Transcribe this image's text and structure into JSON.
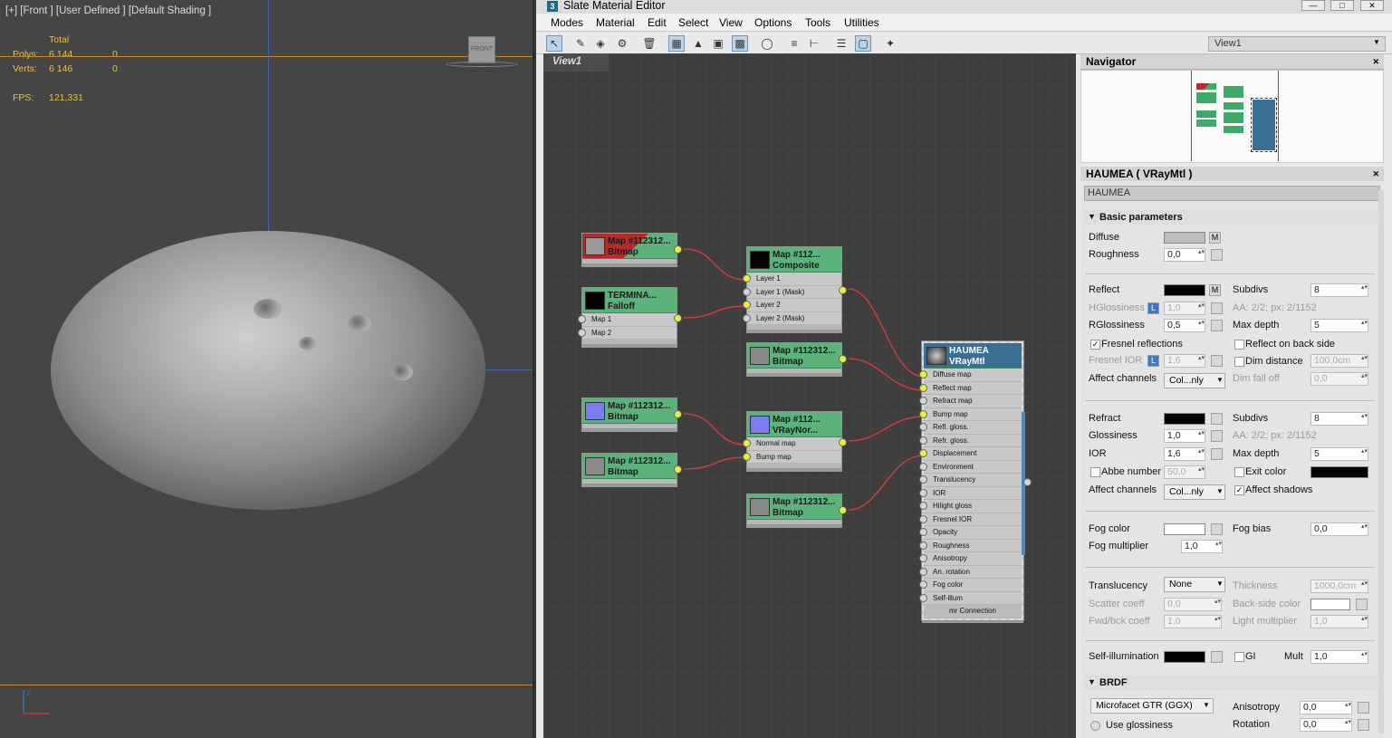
{
  "viewport": {
    "label": "[+] [Front ] [User Defined ] [Default Shading ]",
    "total_label": "Total",
    "polys_label": "Polys:",
    "polys_value": "6 144",
    "polys_sel": "0",
    "verts_label": "Verts:",
    "verts_value": "6 146",
    "verts_sel": "0",
    "fps_label": "FPS:",
    "fps_value": "121,331",
    "viewcube_label": "FRONT"
  },
  "editor": {
    "title": "Slate Material Editor",
    "menus": [
      "Modes",
      "Material",
      "Edit",
      "Select",
      "View",
      "Options",
      "Tools",
      "Utilities"
    ],
    "view_select": "View1",
    "view_tab": "View1"
  },
  "nodes": {
    "bitmap1": {
      "line1": "Map #112312...",
      "line2": "Bitmap"
    },
    "falloff": {
      "line1": "TERMINA...",
      "line2": "Falloff",
      "slots": [
        "Map 1",
        "Map 2"
      ]
    },
    "composite": {
      "line1": "Map #112...",
      "line2": "Composite",
      "slots": [
        "Layer 1",
        "Layer 1 (Mask)",
        "Layer 2",
        "Layer 2 (Mask)"
      ]
    },
    "bitmap2": {
      "line1": "Map #112312...",
      "line2": "Bitmap"
    },
    "bitmap3": {
      "line1": "Map #112312...",
      "line2": "Bitmap"
    },
    "vraynormal": {
      "line1": "Map #112...",
      "line2": "VRayNor...",
      "slots": [
        "Normal map",
        "Bump map"
      ]
    },
    "bitmap4": {
      "line1": "Map #112312...",
      "line2": "Bitmap"
    },
    "bitmap5": {
      "line1": "Map #112312...",
      "line2": "Bitmap"
    },
    "haumea": {
      "line1": "HAUMEA",
      "line2": "VRayMtl",
      "slots": [
        "Diffuse map",
        "Reflect map",
        "Refract map",
        "Bump map",
        "Refl. gloss.",
        "Refr. gloss.",
        "Displacement",
        "Environment",
        "Translucency",
        "IOR",
        "Hilight gloss",
        "Fresnel IOR",
        "Opacity",
        "Roughness",
        "Anisotropy",
        "An. rotation",
        "Fog color",
        "Self-illum"
      ],
      "footer": "mr Connection"
    }
  },
  "navigator": {
    "title": "Navigator"
  },
  "params": {
    "title": "HAUMEA  ( VRayMtl )",
    "name_field": "HAUMEA",
    "section_basic": "Basic parameters",
    "section_brdf": "BRDF",
    "diffuse": "Diffuse",
    "m": "M",
    "roughness": "Roughness",
    "roughness_val": "0,0",
    "reflect": "Reflect",
    "subdivs": "Subdivs",
    "subdivs_val": "8",
    "hglossiness": "HGlossiness",
    "hgloss_val": "1,0",
    "l": "L",
    "aa1": "AA: 2/2; px: 2/1152",
    "rglossiness": "RGlossiness",
    "rgloss_val": "0,5",
    "max_depth": "Max depth",
    "max_depth_val": "5",
    "fresnel": "Fresnel reflections",
    "reflect_back": "Reflect on back side",
    "fresnel_ior": "Fresnel IOR",
    "fresnel_ior_val": "1,6",
    "dim_distance": "Dim distance",
    "dim_distance_val": "100,0cm",
    "affect_channels": "Affect channels",
    "affect_val": "Col...nly",
    "dim_falloff": "Dim fall off",
    "dim_falloff_val": "0,0",
    "refract": "Refract",
    "refr_subdivs_val": "8",
    "glossiness": "Glossiness",
    "gloss_val": "1,0",
    "aa2": "AA: 2/2; px: 2/1152",
    "ior": "IOR",
    "ior_val": "1,6",
    "refr_max_depth_val": "5",
    "abbe": "Abbe number",
    "abbe_val": "50,0",
    "exit_color": "Exit color",
    "affect_channels2": "Affect channels",
    "affect_val2": "Col...nly",
    "affect_shadows": "Affect shadows",
    "fog_color": "Fog color",
    "fog_bias": "Fog bias",
    "fog_bias_val": "0,0",
    "fog_mult": "Fog multiplier",
    "fog_mult_val": "1,0",
    "translucency": "Translucency",
    "transl_val": "None",
    "thickness": "Thickness",
    "thickness_val": "1000,0cm",
    "scatter": "Scatter coeff",
    "scatter_val": "0,0",
    "backside": "Back-side color",
    "fwdbck": "Fwd/bck coeff",
    "fwdbck_val": "1,0",
    "light_mult": "Light multiplier",
    "light_mult_val": "1,0",
    "self_illum": "Self-illumination",
    "gi": "GI",
    "mult": "Mult",
    "mult_val": "1,0",
    "brdf_type": "Microfacet GTR (GGX)",
    "anisotropy": "Anisotropy",
    "aniso_val": "0,0",
    "use_gloss": "Use glossiness",
    "rotation": "Rotation",
    "rotation_val": "0,0"
  },
  "colors": {
    "accent": "#5bb27a",
    "haumea_header": "#3c6f94",
    "wire": "#e03c3c",
    "socket": "#e7f03b"
  }
}
